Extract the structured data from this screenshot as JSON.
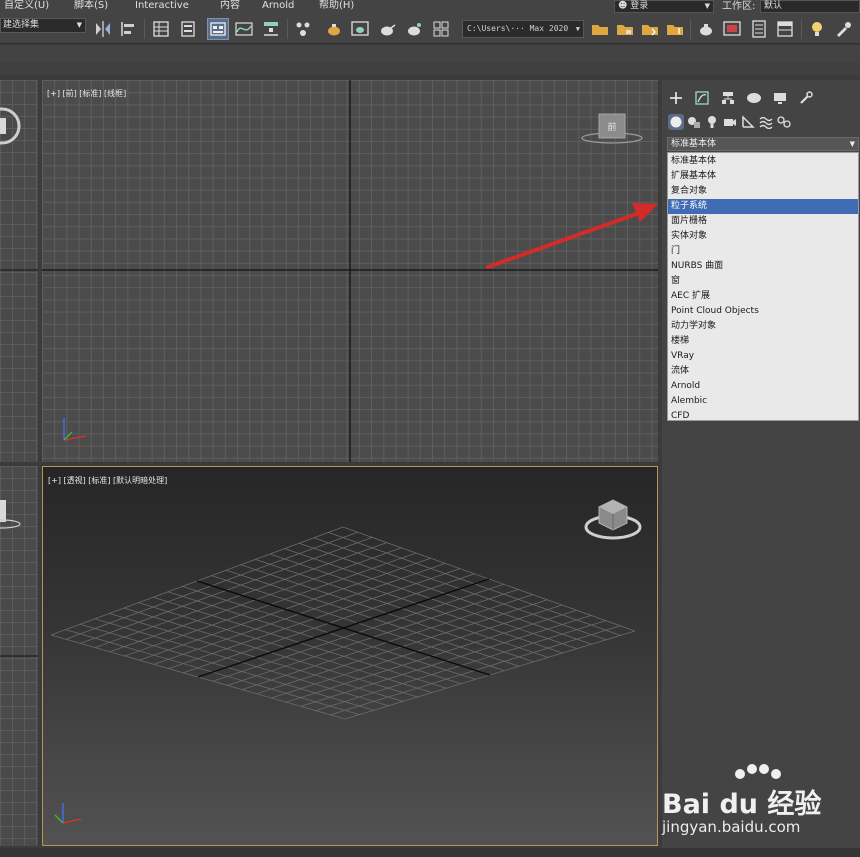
{
  "menu": {
    "items": [
      "自定义(U)",
      "脚本(S)",
      "Interactive",
      "内容",
      "Arnold",
      "帮助(H)"
    ],
    "login": "登录",
    "workspace_label": "工作区:",
    "workspace_value": "默认"
  },
  "toolbar": {
    "selection_set": "建选择集",
    "project_path": "C:\\Users\\··· Max 2020"
  },
  "viewports": {
    "front_label": "[+] [前] [标准] [线框]",
    "perspective_label": "[+] [透视] [标准] [默认明暗处理]",
    "viewcube_label": "前"
  },
  "command_panel": {
    "category_selected": "标准基本体",
    "options": [
      "标准基本体",
      "扩展基本体",
      "复合对象",
      "粒子系统",
      "面片栅格",
      "实体对象",
      "门",
      "NURBS 曲面",
      "窗",
      "AEC 扩展",
      "Point Cloud Objects",
      "动力学对象",
      "楼梯",
      "VRay",
      "流体",
      "Arnold",
      "Alembic",
      "CFD"
    ],
    "highlighted_option": "粒子系统"
  },
  "watermark": {
    "brand": "Bai du 经验",
    "url": "jingyan.baidu.com"
  },
  "colors": {
    "accent_selection": "#3f6cb4",
    "active_viewport_border": "#b69654",
    "arrow": "#d42a2a"
  }
}
